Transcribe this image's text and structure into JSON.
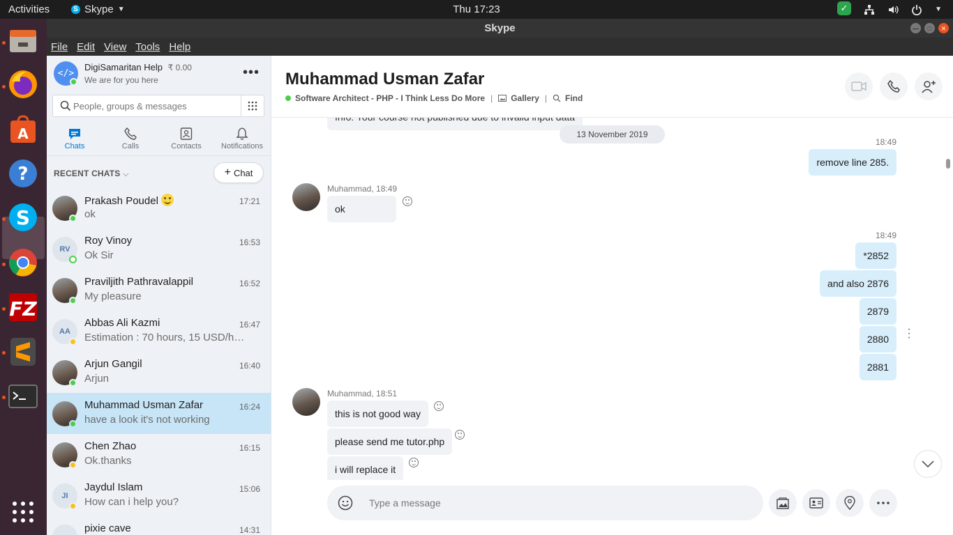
{
  "system": {
    "activities": "Activities",
    "app_name": "Skype",
    "clock": "Thu 17:23"
  },
  "window": {
    "title": "Skype"
  },
  "menu": [
    "File",
    "Edit",
    "View",
    "Tools",
    "Help"
  ],
  "profile": {
    "name": "DigiSamaritan Help",
    "credit": "₹ 0.00",
    "mood": "We are for you here"
  },
  "search": {
    "placeholder": "People, groups & messages"
  },
  "nav": {
    "chats": "Chats",
    "calls": "Calls",
    "contacts": "Contacts",
    "notifications": "Notifications"
  },
  "recent": {
    "heading": "RECENT CHATS",
    "new_chat": "Chat"
  },
  "chats": [
    {
      "name": "Prakash Poudel",
      "message": "ok",
      "time": "17:21",
      "initials": "",
      "status": "online",
      "photo": true,
      "emoji": true
    },
    {
      "name": "Roy Vinoy",
      "message": "Ok Sir",
      "time": "16:53",
      "initials": "RV",
      "status": "online-hollow",
      "photo": false
    },
    {
      "name": "Praviljith Pathravalappil",
      "message": "My pleasure",
      "time": "16:52",
      "initials": "",
      "status": "online",
      "photo": true
    },
    {
      "name": "Abbas Ali Kazmi",
      "message": "Estimation : 70 hours, 15 USD/hr...",
      "time": "16:47",
      "initials": "AA",
      "status": "away",
      "photo": false
    },
    {
      "name": "Arjun Gangil",
      "message": "Arjun",
      "time": "16:40",
      "initials": "",
      "status": "online",
      "photo": true
    },
    {
      "name": "Muhammad Usman Zafar",
      "message": "have a look it's not working",
      "time": "16:24",
      "initials": "",
      "status": "online",
      "photo": true,
      "selected": true
    },
    {
      "name": "Chen Zhao",
      "message": "Ok.thanks",
      "time": "16:15",
      "initials": "",
      "status": "away",
      "photo": true
    },
    {
      "name": "Jaydul Islam",
      "message": "How can i help you?",
      "time": "15:06",
      "initials": "JI",
      "status": "away",
      "photo": false
    },
    {
      "name": "pixie cave",
      "message": "",
      "time": "14:31",
      "initials": "",
      "status": "",
      "photo": false
    }
  ],
  "conversation": {
    "name": "Muhammad Usman Zafar",
    "mood": "Software Architect - PHP - I Think Less Do More",
    "gallery": "Gallery",
    "find": "Find",
    "date_divider": "13 November 2019",
    "cut_text": "Info: Your course not published due to invalid input data",
    "messages": {
      "out1_time": "18:49",
      "out1": "remove line 285.",
      "in1_meta": "Muhammad, 18:49",
      "in1": "ok",
      "out2_time": "18:49",
      "out2a": "*2852",
      "out2b": "and also 2876",
      "out2c": "2879",
      "out2d": "2880",
      "out2e": "2881",
      "in2_meta": "Muhammad, 18:51",
      "in2a": "this is not good way",
      "in2b": "please send me tutor.php",
      "in2c": "i will replace it"
    },
    "composer_placeholder": "Type a message"
  },
  "colors": {
    "accent": "#0078d4",
    "outgoing_bubble": "#d8eefb",
    "incoming_bubble": "#f0f2f5",
    "selected_chat": "#c7e5f7",
    "online": "#4cce4c",
    "away": "#f8c21c"
  }
}
